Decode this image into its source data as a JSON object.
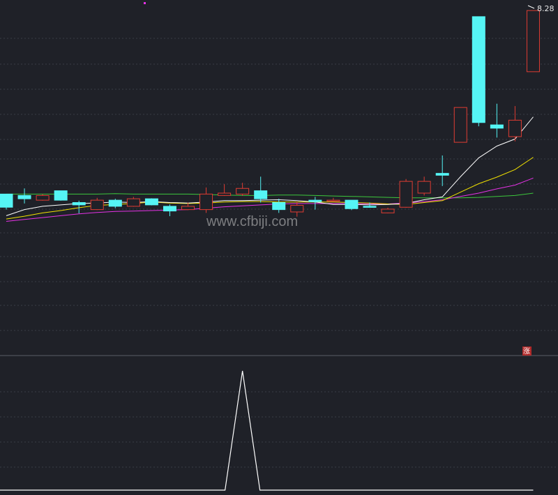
{
  "chart_data": {
    "type": "candlestick",
    "price_axis": {
      "min": 2.8,
      "max": 8.4
    },
    "grid": "dashed-horizontal",
    "colors": {
      "background": "#1f2128",
      "up": "#e03c32",
      "down": "#55f5f5",
      "ma5": "#ffffff",
      "ma10": "#f2e200",
      "ma20": "#e632e6",
      "ma60": "#3cc83c",
      "signal": "#ffffff",
      "divider": "#5a5d66",
      "grid": "#3a3d46"
    },
    "labels": {
      "high_price": "8.28",
      "watermark": "www.cfbiji.com",
      "badge": "涨"
    },
    "candles": [
      {
        "o": 4.38,
        "h": 4.38,
        "c": 4.1,
        "l": 4.05
      },
      {
        "o": 4.35,
        "h": 4.5,
        "c": 4.28,
        "l": 4.18
      },
      {
        "o": 4.25,
        "h": 4.38,
        "c": 4.35,
        "l": 4.24
      },
      {
        "o": 4.45,
        "h": 4.45,
        "c": 4.25,
        "l": 4.24
      },
      {
        "o": 4.2,
        "h": 4.24,
        "c": 4.15,
        "l": 3.97
      },
      {
        "o": 4.05,
        "h": 4.3,
        "c": 4.25,
        "l": 4.04
      },
      {
        "o": 4.25,
        "h": 4.28,
        "c": 4.12,
        "l": 4.08
      },
      {
        "o": 4.12,
        "h": 4.32,
        "c": 4.28,
        "l": 4.11
      },
      {
        "o": 4.28,
        "h": 4.29,
        "c": 4.15,
        "l": 4.14
      },
      {
        "o": 4.12,
        "h": 4.16,
        "c": 4.02,
        "l": 3.91
      },
      {
        "o": 4.05,
        "h": 4.2,
        "c": 4.12,
        "l": 4.04
      },
      {
        "o": 4.05,
        "h": 4.52,
        "c": 4.38,
        "l": 3.98
      },
      {
        "o": 4.35,
        "h": 4.59,
        "c": 4.4,
        "l": 4.34
      },
      {
        "o": 4.38,
        "h": 4.62,
        "c": 4.5,
        "l": 4.34
      },
      {
        "o": 4.45,
        "h": 4.75,
        "c": 4.28,
        "l": 4.2
      },
      {
        "o": 4.2,
        "h": 4.28,
        "c": 4.05,
        "l": 3.98
      },
      {
        "o": 4.0,
        "h": 4.22,
        "c": 4.14,
        "l": 3.9
      },
      {
        "o": 4.25,
        "h": 4.32,
        "c": 4.22,
        "l": 4.05
      },
      {
        "o": 4.24,
        "h": 4.3,
        "c": 4.25,
        "l": 4.23
      },
      {
        "o": 4.25,
        "h": 4.25,
        "c": 4.07,
        "l": 4.04
      },
      {
        "o": 4.12,
        "h": 4.2,
        "c": 4.1,
        "l": 4.09
      },
      {
        "o": 3.98,
        "h": 4.09,
        "c": 4.06,
        "l": 3.97
      },
      {
        "o": 4.1,
        "h": 4.7,
        "c": 4.65,
        "l": 4.09
      },
      {
        "o": 4.4,
        "h": 4.75,
        "c": 4.65,
        "l": 4.35
      },
      {
        "o": 4.82,
        "h": 5.2,
        "c": 4.78,
        "l": 4.55
      },
      {
        "o": 5.48,
        "h": 6.22,
        "c": 6.22,
        "l": 5.48
      },
      {
        "o": 8.15,
        "h": 8.15,
        "c": 5.9,
        "l": 5.82
      },
      {
        "o": 5.85,
        "h": 6.3,
        "c": 5.78,
        "l": 5.58
      },
      {
        "o": 5.6,
        "h": 6.25,
        "c": 5.95,
        "l": 5.5
      },
      {
        "o": 6.98,
        "h": 8.28,
        "c": 8.28,
        "l": 6.98
      }
    ],
    "ma5": [
      3.92,
      4.05,
      4.12,
      4.15,
      4.18,
      4.19,
      4.21,
      4.2,
      4.22,
      4.2,
      4.19,
      4.21,
      4.24,
      4.24,
      4.25,
      4.26,
      4.24,
      4.21,
      4.16,
      4.16,
      4.15,
      4.16,
      4.18,
      4.26,
      4.32,
      4.75,
      5.15,
      5.4,
      5.55,
      6.02
    ],
    "ma10": [
      3.85,
      3.91,
      3.98,
      4.03,
      4.09,
      4.14,
      4.16,
      4.18,
      4.21,
      4.19,
      4.18,
      4.19,
      4.21,
      4.22,
      4.22,
      4.21,
      4.21,
      4.21,
      4.21,
      4.2,
      4.19,
      4.17,
      4.16,
      4.2,
      4.24,
      4.42,
      4.6,
      4.74,
      4.9,
      5.16
    ],
    "ma20": [
      3.8,
      3.84,
      3.88,
      3.92,
      3.96,
      3.99,
      4.01,
      4.02,
      4.03,
      4.04,
      4.05,
      4.08,
      4.11,
      4.13,
      4.15,
      4.17,
      4.18,
      4.18,
      4.18,
      4.18,
      4.17,
      4.17,
      4.19,
      4.22,
      4.26,
      4.33,
      4.4,
      4.49,
      4.57,
      4.72
    ],
    "ma60": [
      4.38,
      4.38,
      4.38,
      4.38,
      4.38,
      4.38,
      4.39,
      4.38,
      4.38,
      4.38,
      4.38,
      4.37,
      4.36,
      4.35,
      4.35,
      4.36,
      4.36,
      4.35,
      4.34,
      4.33,
      4.32,
      4.31,
      4.3,
      4.3,
      4.3,
      4.3,
      4.31,
      4.33,
      4.35,
      4.4
    ],
    "signal": [
      0,
      0,
      0,
      0,
      0,
      0,
      0,
      0,
      0,
      0,
      0,
      0,
      0,
      1,
      0,
      0,
      0,
      0,
      0,
      0,
      0,
      0,
      0,
      0,
      0,
      0,
      0,
      0,
      0,
      0
    ]
  }
}
